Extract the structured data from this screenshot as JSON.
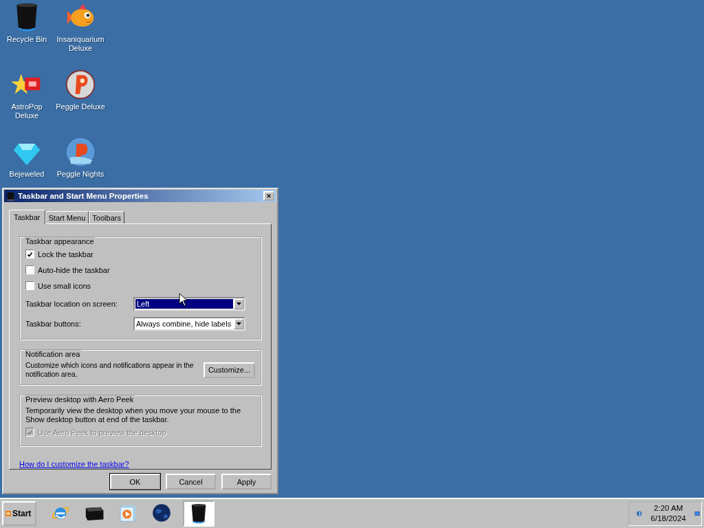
{
  "desktop_icons": [
    {
      "label": "Recycle Bin",
      "kind": "bin"
    },
    {
      "label": "Insaniquarium Deluxe",
      "kind": "fish"
    },
    {
      "label": "AstroPop Deluxe",
      "kind": "star"
    },
    {
      "label": "Peggle Deluxe",
      "kind": "peggle"
    },
    {
      "label": "Bejeweled",
      "kind": "gem"
    },
    {
      "label": "Peggle Nights",
      "kind": "nights"
    }
  ],
  "dialog": {
    "title": "Taskbar and Start Menu Properties",
    "tabs": [
      {
        "label": "Taskbar",
        "selected": true
      },
      {
        "label": "Start Menu",
        "selected": false
      },
      {
        "label": "Toolbars",
        "selected": false
      }
    ],
    "appearance": {
      "title": "Taskbar appearance",
      "checkboxes": [
        {
          "label": "Lock the taskbar",
          "checked": true
        },
        {
          "label": "Auto-hide the taskbar",
          "checked": false
        },
        {
          "label": "Use small icons",
          "checked": false
        }
      ],
      "selects": [
        {
          "label": "Taskbar location on screen:",
          "value": "Left",
          "focused": true
        },
        {
          "label": "Taskbar buttons:",
          "value": "Always combine, hide labels",
          "focused": false
        }
      ]
    },
    "notification": {
      "title": "Notification area",
      "text": "Customize which icons and notifications appear in the notification area.",
      "button": "Customize..."
    },
    "peek": {
      "title": "Preview desktop with Aero Peek",
      "text": "Temporarily view the desktop when you move your mouse to the Show desktop button at end of the taskbar.",
      "checkbox": {
        "label": "Use Aero Peek to preview the desktop",
        "checked": true,
        "disabled": true
      }
    },
    "link": "How do I customize the taskbar?",
    "buttons": [
      {
        "label": "OK",
        "default": true
      },
      {
        "label": "Cancel",
        "default": false
      },
      {
        "label": "Apply",
        "default": false
      }
    ]
  },
  "taskbar": {
    "start": "Start",
    "apps": [
      {
        "kind": "ie",
        "selected": false
      },
      {
        "kind": "box",
        "selected": false
      },
      {
        "kind": "media",
        "selected": false
      },
      {
        "kind": "globe",
        "selected": false
      },
      {
        "kind": "bin",
        "selected": true
      }
    ],
    "time": "2:20 AM",
    "date": "6/18/2024"
  }
}
